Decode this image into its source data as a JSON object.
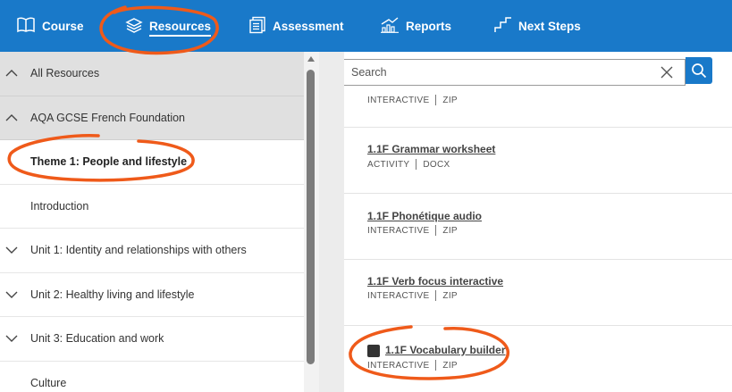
{
  "nav": {
    "items": [
      {
        "label": "Course",
        "icon": "book-icon",
        "active": false
      },
      {
        "label": "Resources",
        "icon": "layers-icon",
        "active": true
      },
      {
        "label": "Assessment",
        "icon": "clipboard-icon",
        "active": false
      },
      {
        "label": "Reports",
        "icon": "bar-chart-icon",
        "active": false
      },
      {
        "label": "Next Steps",
        "icon": "steps-icon",
        "active": false
      }
    ]
  },
  "sidebar": {
    "items": [
      {
        "label": "All Resources",
        "chevron": "up",
        "style": "grey"
      },
      {
        "label": "AQA GCSE French Foundation",
        "chevron": "up",
        "style": "grey"
      },
      {
        "label": "Theme 1: People and lifestyle",
        "chevron": "none",
        "style": "theme"
      },
      {
        "label": "Introduction",
        "chevron": "none",
        "style": "plain"
      },
      {
        "label": "Unit 1: Identity and relationships with others",
        "chevron": "down",
        "style": "plain"
      },
      {
        "label": "Unit 2: Healthy living and lifestyle",
        "chevron": "down",
        "style": "plain"
      },
      {
        "label": "Unit 3: Education and work",
        "chevron": "down",
        "style": "plain"
      },
      {
        "label": "Culture",
        "chevron": "none",
        "style": "plain"
      }
    ]
  },
  "search": {
    "placeholder": "Search"
  },
  "resources": [
    {
      "title": "",
      "type": "INTERACTIVE",
      "format": "ZIP"
    },
    {
      "title": "1.1F Grammar worksheet",
      "type": "ACTIVITY",
      "format": "DOCX"
    },
    {
      "title": "1.1F Phonétique audio",
      "type": "INTERACTIVE",
      "format": "ZIP"
    },
    {
      "title": "1.1F Verb focus interactive",
      "type": "INTERACTIVE",
      "format": "ZIP"
    },
    {
      "title": "1.1F Vocabulary builder",
      "type": "INTERACTIVE",
      "format": "ZIP"
    }
  ],
  "colors": {
    "nav_bg": "#1979c9",
    "annotation": "#ef5a1a",
    "sidebar_grey": "#e0e0e0"
  }
}
